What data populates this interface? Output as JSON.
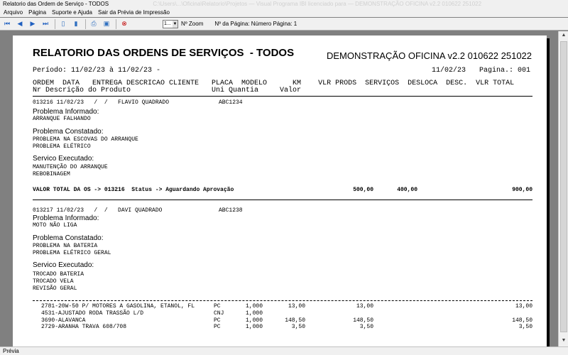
{
  "window": {
    "title": "Relatorio das Ordem de Serviço - TODOS",
    "title_blurred": "C:\\Users\\...\\Oficina\\Relatorio\\Projetos — Visual Programa IBI licenciado para — DEMONSTRAÇÃO OFICINA v2.2 010622 251022"
  },
  "menu": [
    "Arquivo",
    "Página",
    "Suporte e Ajuda",
    "Sair da Prévia de Impressão"
  ],
  "toolbar": {
    "icons": [
      "first-page-icon",
      "prev-page-icon",
      "next-page-icon",
      "last-page-icon",
      "page-icon",
      "two-pages-icon",
      "print-icon",
      "save-icon",
      "close-icon"
    ],
    "zoom_value": "1...",
    "zoom_label": "Nº Zoom",
    "page_label": "Nº da Página: Número Página: 1"
  },
  "status": {
    "text": "Prévia"
  },
  "report": {
    "title": "RELATORIO DAS ORDENS DE SERVIÇOS  - TODOS",
    "company": "DEMONSTRAÇÃO OFICINA v2.2 010622 251022",
    "period": "Período: 11/02/23 à 11/02/23 -",
    "print_date": "11/02/23",
    "page": "Pagina.: 001",
    "header1": "ORDEM  DATA   ENTREGA DESCRICAO CLIENTE   PLACA  MODELO      KM    VLR PRODS  SERVIÇOS  DESLOCA  DESC.  VLR TOTAL",
    "header2": "Nr Descrição do Produto                   Uni Quantia     Valor",
    "labels": {
      "problema_informado": "Problema Informado:",
      "problema_constatado": "Problema Constatado:",
      "servico_executado": "Servico Executado:"
    },
    "orders": [
      {
        "line": "013216 11/02/23   /  /   FLAVIO QUADRADO",
        "placa": "ABC1234",
        "informado": [
          "ARRANQUE FALHANDO"
        ],
        "constatado": [
          "PROBLEMA NA ESCOVAS DO ARRANQUE",
          "PROBLEMA ELÉTRICO"
        ],
        "executado": [
          "MANUTENÇÃO DO ARRANQUE",
          "REBOBINAGEM"
        ],
        "total_label": "VALOR TOTAL DA OS -> 013216  Status -> Aguardando Aprovação",
        "vlr_prods": "500,00",
        "servicos": "400,00",
        "vlr_total": "900,00"
      },
      {
        "line": "013217 11/02/23   /  /   DAVI QUADRADO",
        "placa": "ABC1238",
        "informado": [
          "MOTO NÃO LIGA"
        ],
        "constatado": [
          "PROBLEMA NA BATERIA",
          "PROBLEMA ELÉTRICO GERAL"
        ],
        "executado": [
          "TROCADO BATERIA",
          "TROCADO VELA",
          "REVISÃO GERAL"
        ],
        "items": [
          {
            "desc": "2781-20W-50 P/ MOTORES A GASOLINA, ETANOL, FL",
            "uni": "PC",
            "qty": "1,000",
            "valor": "13,00",
            "prods": "13,00",
            "total": "13,00"
          },
          {
            "desc": "4531-AJUSTADO RODA TRASSÃO L/D",
            "uni": "CNJ",
            "qty": "1,000",
            "valor": "",
            "prods": "",
            "total": ""
          },
          {
            "desc": "3690-ALAVANCA",
            "uni": "PC",
            "qty": "1,000",
            "valor": "148,50",
            "prods": "148,50",
            "total": "148,50"
          },
          {
            "desc": "2729-ARANHA TRAVA 608/708",
            "uni": "PC",
            "qty": "1,000",
            "valor": "3,50",
            "prods": "3,50",
            "total": "3,50"
          }
        ]
      }
    ]
  }
}
